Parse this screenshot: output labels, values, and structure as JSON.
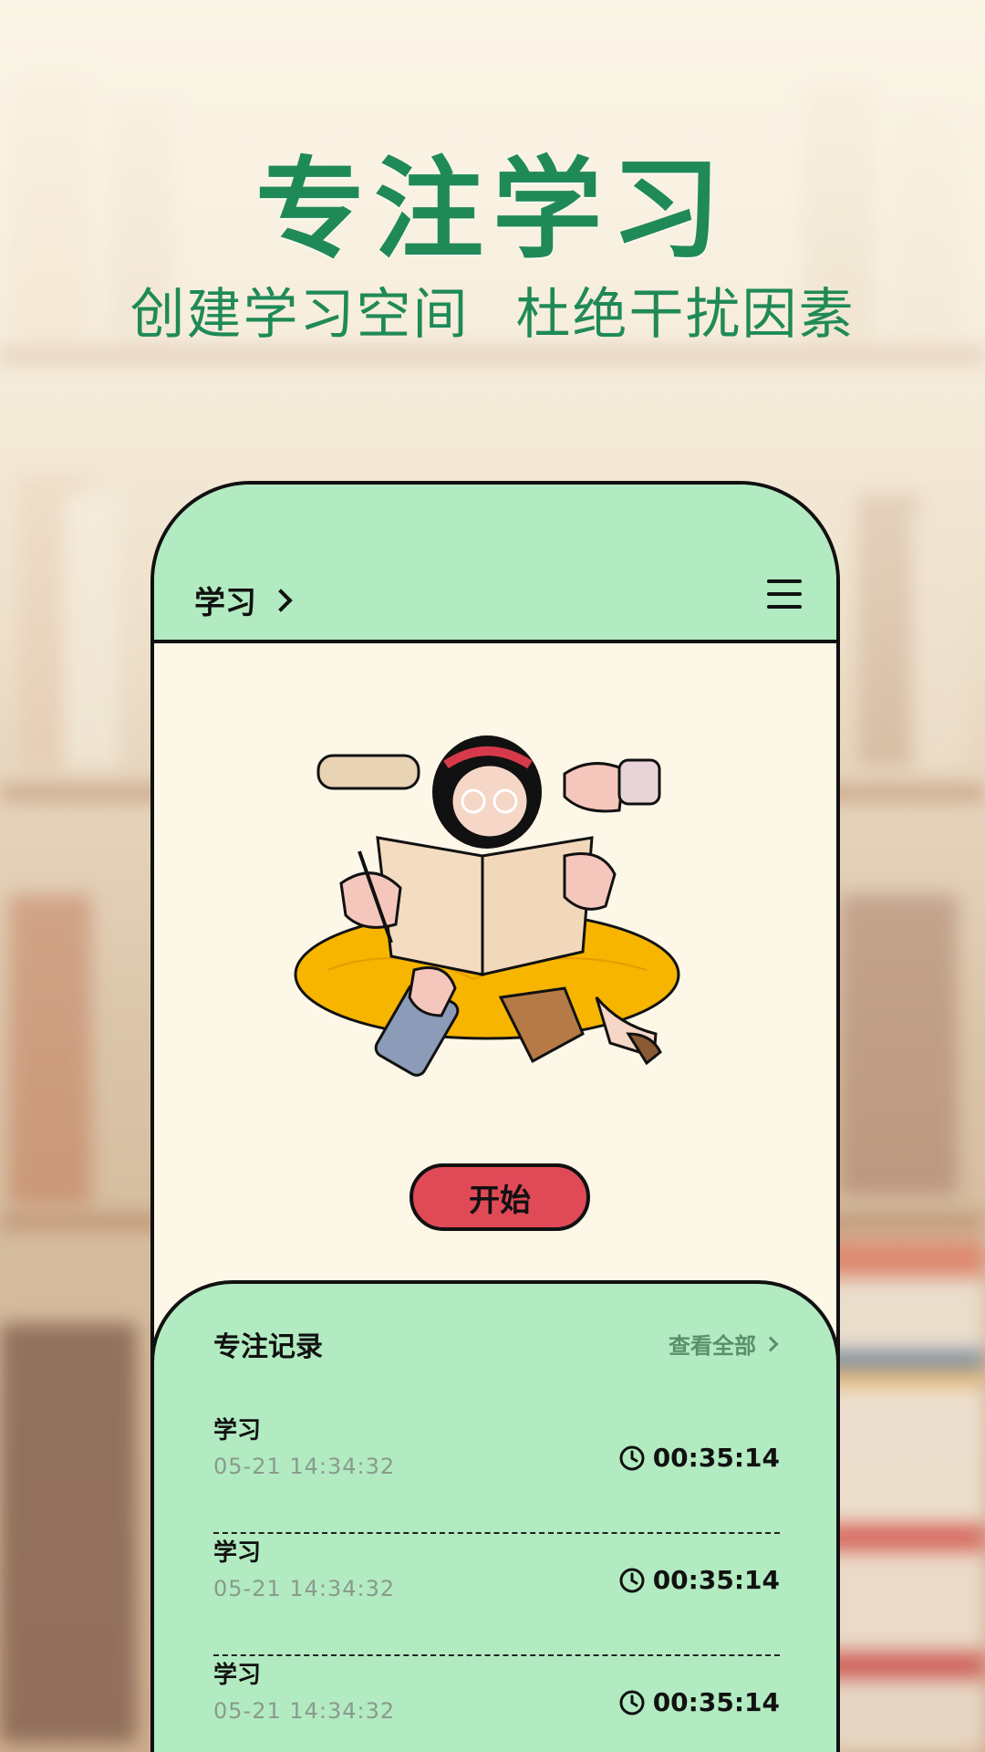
{
  "hero": {
    "title": "专注学习",
    "subtitle": "创建学习空间  杜绝干扰因素"
  },
  "app": {
    "header": {
      "title": "学习",
      "chevron_icon": "chevron-right-icon",
      "menu_icon": "hamburger-menu-icon"
    },
    "illustration": "girl-reading-multitasking-illustration",
    "start_button": "开始",
    "records": {
      "title": "专注记录",
      "view_all": "查看全部",
      "items": [
        {
          "name": "学习",
          "time": "05-21  14:34:32",
          "duration": "00:35:14"
        },
        {
          "name": "学习",
          "time": "05-21  14:34:32",
          "duration": "00:35:14"
        },
        {
          "name": "学习",
          "time": "05-21  14:34:32",
          "duration": "00:35:14"
        }
      ]
    }
  },
  "colors": {
    "accent_green": "#1f8a57",
    "header_bg": "#b2ebc1",
    "panel_bg": "#fcf7e7",
    "start_button": "#e04a57"
  }
}
